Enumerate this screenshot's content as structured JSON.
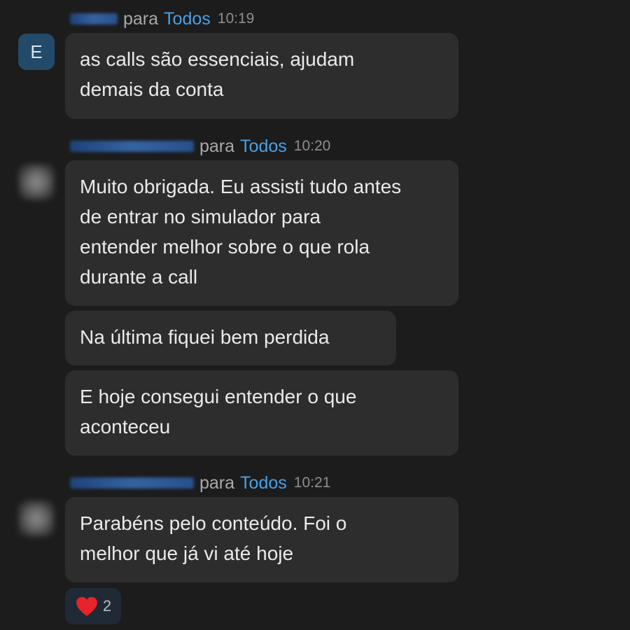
{
  "messages": [
    {
      "avatar_letter": "E",
      "recipient_prefix": "para",
      "recipient": "Todos",
      "time": "10:19",
      "bubbles": [
        "as calls são essenciais, ajudam\ndemais da conta"
      ]
    },
    {
      "recipient_prefix": "para",
      "recipient": "Todos",
      "time": "10:20",
      "bubbles": [
        "Muito obrigada. Eu assisti tudo antes\nde entrar no simulador para\nentender melhor sobre o que rola\ndurante a call",
        "Na última fiquei bem perdida",
        "E hoje consegui entender o que\naconteceu"
      ]
    },
    {
      "recipient_prefix": "para",
      "recipient": "Todos",
      "time": "10:21",
      "bubbles": [
        "Parabéns pelo conteúdo. Foi o\nmelhor que já vi até hoje"
      ]
    }
  ],
  "reaction": {
    "icon": "heart-icon",
    "count": "2",
    "color": "#e8232b"
  },
  "colors": {
    "background": "#1c1c1c",
    "bubble": "#2d2d2d",
    "recipient": "#4aa0e6"
  }
}
